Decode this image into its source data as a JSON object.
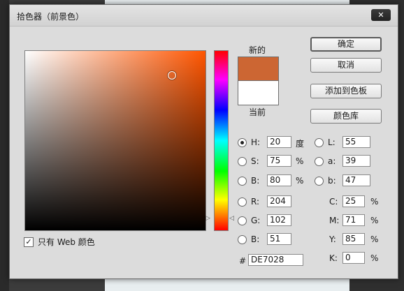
{
  "dialog": {
    "title": "拾色器（前景色）",
    "close_icon": "close-icon"
  },
  "picker": {
    "base_hue_color": "#ff5500",
    "web_only_label": "只有 Web 颜色",
    "web_only_checked": true
  },
  "preview": {
    "new_label": "新的",
    "current_label": "当前",
    "new_color": "#cc6633",
    "current_color": "#ffffff"
  },
  "buttons": {
    "ok": "确定",
    "cancel": "取消",
    "add_to_swatches": "添加到色板",
    "color_libraries": "颜色库"
  },
  "hsb": {
    "h_label": "H:",
    "h_value": "20",
    "h_unit": "度",
    "s_label": "S:",
    "s_value": "75",
    "s_unit": "%",
    "b_label": "B:",
    "b_value": "80",
    "b_unit": "%",
    "selected": "H"
  },
  "lab": {
    "l_label": "L:",
    "l_value": "55",
    "a_label": "a:",
    "a_value": "39",
    "b_label": "b:",
    "b_value": "47"
  },
  "rgb": {
    "r_label": "R:",
    "r_value": "204",
    "g_label": "G:",
    "g_value": "102",
    "b_label": "B:",
    "b_value": "51"
  },
  "cmyk": {
    "c_label": "C:",
    "c_value": "25",
    "m_label": "M:",
    "m_value": "71",
    "y_label": "Y:",
    "y_value": "85",
    "k_label": "K:",
    "k_value": "0",
    "unit": "%"
  },
  "hex": {
    "label": "#",
    "value": "DE7028"
  }
}
